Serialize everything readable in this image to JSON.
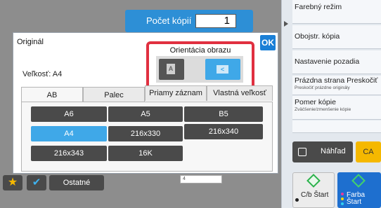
{
  "header": {
    "copies_label": "Počet kópií",
    "copies_value": "1"
  },
  "dialog": {
    "title": "Originál",
    "ok_label": "OK",
    "orientation_label": "Orientácia obrazu",
    "portrait_glyph": "A",
    "landscape_glyph": "<",
    "orientation_selected": "landscape",
    "size_label": "Veľkosť: A4",
    "tabs": [
      {
        "label": "AB",
        "active": true
      },
      {
        "label": "Palec",
        "active": false
      },
      {
        "label": "Priamy záznam",
        "active": false
      },
      {
        "label": "Vlastná veľkosť",
        "active": false
      }
    ],
    "paper_sizes": [
      {
        "label": "A6",
        "selected": false
      },
      {
        "label": "A5",
        "selected": false
      },
      {
        "label": "B5",
        "selected": false
      },
      {
        "label": "A4",
        "selected": true
      },
      {
        "label": "216x330",
        "selected": false
      },
      {
        "label": "216x340",
        "selected": false
      },
      {
        "label": "216x343",
        "selected": false
      },
      {
        "label": "16K",
        "selected": false
      }
    ]
  },
  "right_panel": {
    "items": [
      {
        "label": "Farebný režim",
        "sub": ""
      },
      {
        "label": "Obojstr. kópia",
        "sub": ""
      },
      {
        "label": "Nastavenie pozadia",
        "sub": ""
      },
      {
        "label": "Prázdna strana Preskočiť",
        "sub": "Preskočiť prázdne originály"
      },
      {
        "label": "Pomer kópie",
        "sub": "Zväčšenie/zmenšenie kópie"
      }
    ],
    "preview_label": "Náhľad",
    "ca_label": "CA",
    "bw_start_label": "C/b Štart",
    "color_start_label": "Farba Štart"
  },
  "bottom_bar": {
    "others_label": "Ostatné",
    "small_field_text": "4"
  },
  "colors": {
    "accent_blue": "#3fa8e8",
    "highlight_red": "#e03040",
    "ca_yellow": "#f5b800",
    "start_green": "#2bb24c"
  }
}
